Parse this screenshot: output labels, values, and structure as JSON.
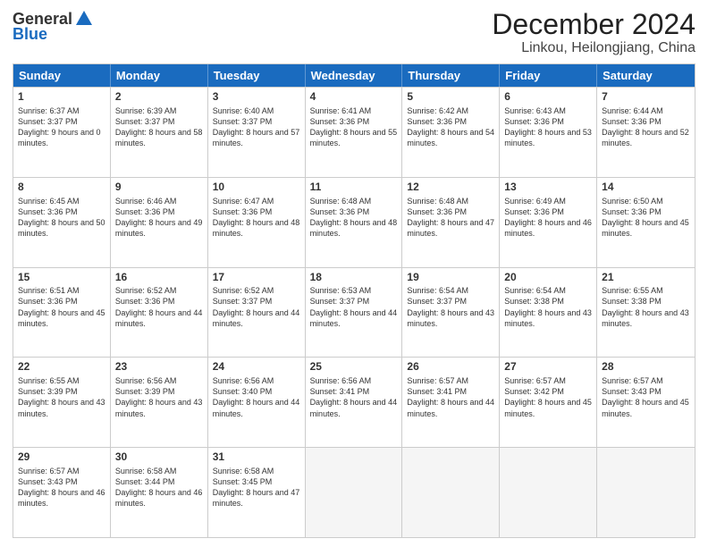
{
  "header": {
    "logo_general": "General",
    "logo_blue": "Blue",
    "month_title": "December 2024",
    "location": "Linkou, Heilongjiang, China"
  },
  "days": [
    "Sunday",
    "Monday",
    "Tuesday",
    "Wednesday",
    "Thursday",
    "Friday",
    "Saturday"
  ],
  "weeks": [
    [
      {
        "day": "1",
        "sunrise": "6:37 AM",
        "sunset": "3:37 PM",
        "daylight": "9 hours and 0 minutes."
      },
      {
        "day": "2",
        "sunrise": "6:39 AM",
        "sunset": "3:37 PM",
        "daylight": "8 hours and 58 minutes."
      },
      {
        "day": "3",
        "sunrise": "6:40 AM",
        "sunset": "3:37 PM",
        "daylight": "8 hours and 57 minutes."
      },
      {
        "day": "4",
        "sunrise": "6:41 AM",
        "sunset": "3:36 PM",
        "daylight": "8 hours and 55 minutes."
      },
      {
        "day": "5",
        "sunrise": "6:42 AM",
        "sunset": "3:36 PM",
        "daylight": "8 hours and 54 minutes."
      },
      {
        "day": "6",
        "sunrise": "6:43 AM",
        "sunset": "3:36 PM",
        "daylight": "8 hours and 53 minutes."
      },
      {
        "day": "7",
        "sunrise": "6:44 AM",
        "sunset": "3:36 PM",
        "daylight": "8 hours and 52 minutes."
      }
    ],
    [
      {
        "day": "8",
        "sunrise": "6:45 AM",
        "sunset": "3:36 PM",
        "daylight": "8 hours and 50 minutes."
      },
      {
        "day": "9",
        "sunrise": "6:46 AM",
        "sunset": "3:36 PM",
        "daylight": "8 hours and 49 minutes."
      },
      {
        "day": "10",
        "sunrise": "6:47 AM",
        "sunset": "3:36 PM",
        "daylight": "8 hours and 48 minutes."
      },
      {
        "day": "11",
        "sunrise": "6:48 AM",
        "sunset": "3:36 PM",
        "daylight": "8 hours and 48 minutes."
      },
      {
        "day": "12",
        "sunrise": "6:48 AM",
        "sunset": "3:36 PM",
        "daylight": "8 hours and 47 minutes."
      },
      {
        "day": "13",
        "sunrise": "6:49 AM",
        "sunset": "3:36 PM",
        "daylight": "8 hours and 46 minutes."
      },
      {
        "day": "14",
        "sunrise": "6:50 AM",
        "sunset": "3:36 PM",
        "daylight": "8 hours and 45 minutes."
      }
    ],
    [
      {
        "day": "15",
        "sunrise": "6:51 AM",
        "sunset": "3:36 PM",
        "daylight": "8 hours and 45 minutes."
      },
      {
        "day": "16",
        "sunrise": "6:52 AM",
        "sunset": "3:36 PM",
        "daylight": "8 hours and 44 minutes."
      },
      {
        "day": "17",
        "sunrise": "6:52 AM",
        "sunset": "3:37 PM",
        "daylight": "8 hours and 44 minutes."
      },
      {
        "day": "18",
        "sunrise": "6:53 AM",
        "sunset": "3:37 PM",
        "daylight": "8 hours and 44 minutes."
      },
      {
        "day": "19",
        "sunrise": "6:54 AM",
        "sunset": "3:37 PM",
        "daylight": "8 hours and 43 minutes."
      },
      {
        "day": "20",
        "sunrise": "6:54 AM",
        "sunset": "3:38 PM",
        "daylight": "8 hours and 43 minutes."
      },
      {
        "day": "21",
        "sunrise": "6:55 AM",
        "sunset": "3:38 PM",
        "daylight": "8 hours and 43 minutes."
      }
    ],
    [
      {
        "day": "22",
        "sunrise": "6:55 AM",
        "sunset": "3:39 PM",
        "daylight": "8 hours and 43 minutes."
      },
      {
        "day": "23",
        "sunrise": "6:56 AM",
        "sunset": "3:39 PM",
        "daylight": "8 hours and 43 minutes."
      },
      {
        "day": "24",
        "sunrise": "6:56 AM",
        "sunset": "3:40 PM",
        "daylight": "8 hours and 44 minutes."
      },
      {
        "day": "25",
        "sunrise": "6:56 AM",
        "sunset": "3:41 PM",
        "daylight": "8 hours and 44 minutes."
      },
      {
        "day": "26",
        "sunrise": "6:57 AM",
        "sunset": "3:41 PM",
        "daylight": "8 hours and 44 minutes."
      },
      {
        "day": "27",
        "sunrise": "6:57 AM",
        "sunset": "3:42 PM",
        "daylight": "8 hours and 45 minutes."
      },
      {
        "day": "28",
        "sunrise": "6:57 AM",
        "sunset": "3:43 PM",
        "daylight": "8 hours and 45 minutes."
      }
    ],
    [
      {
        "day": "29",
        "sunrise": "6:57 AM",
        "sunset": "3:43 PM",
        "daylight": "8 hours and 46 minutes."
      },
      {
        "day": "30",
        "sunrise": "6:58 AM",
        "sunset": "3:44 PM",
        "daylight": "8 hours and 46 minutes."
      },
      {
        "day": "31",
        "sunrise": "6:58 AM",
        "sunset": "3:45 PM",
        "daylight": "8 hours and 47 minutes."
      },
      null,
      null,
      null,
      null
    ]
  ]
}
